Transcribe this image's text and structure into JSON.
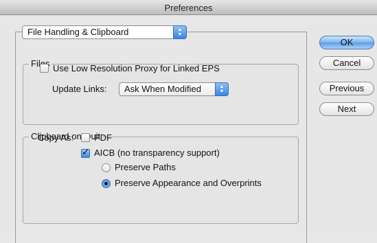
{
  "window": {
    "title": "Preferences"
  },
  "section_popup": {
    "value": "File Handling & Clipboard"
  },
  "files": {
    "title": "Files",
    "low_res_label": "Use Low Resolution Proxy for Linked EPS",
    "low_res_checked": false,
    "update_links_label": "Update Links:",
    "update_links_value": "Ask When Modified"
  },
  "clipboard": {
    "title": "Clipboard on Quit",
    "copy_as_label": "Copy As:",
    "pdf_label": "PDF",
    "pdf_checked": false,
    "aicb_label": "AICB (no transparency support)",
    "aicb_checked": true,
    "preserve_paths_label": "Preserve Paths",
    "preserve_appearance_label": "Preserve Appearance and Overprints",
    "selected_option": "Preserve Appearance and Overprints"
  },
  "buttons": {
    "ok": "OK",
    "cancel": "Cancel",
    "previous": "Previous",
    "next": "Next"
  },
  "icons": {
    "popup_arrows": "updown-arrows-icon",
    "checkbox_check": "checkmark-icon"
  }
}
